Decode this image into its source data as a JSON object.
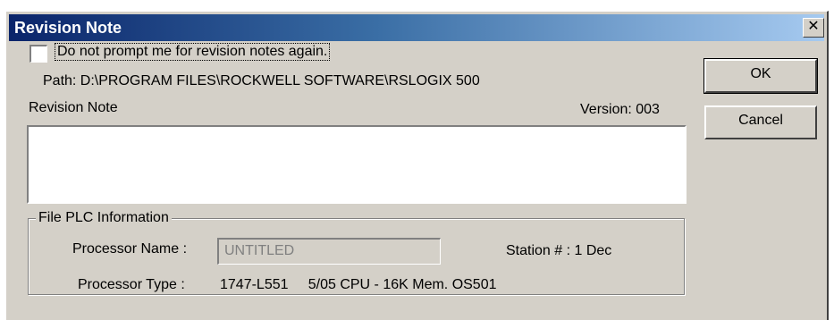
{
  "window": {
    "title": "Revision Note",
    "close_glyph": "✕"
  },
  "prompt_checkbox": {
    "label": "Do not prompt me for revision notes again.",
    "checked": false
  },
  "path": "Path: D:\\PROGRAM FILES\\ROCKWELL SOFTWARE\\RSLOGIX 500",
  "revision": {
    "label": "Revision Note",
    "version": "Version:  003",
    "note_text": ""
  },
  "plc_info": {
    "group_title": "File PLC Information",
    "processor_name_label": "Processor Name :",
    "processor_name_value": "UNTITLED",
    "station": "Station # :  1 Dec",
    "processor_type_label": "Processor Type :",
    "processor_type_value": "1747-L551     5/05 CPU - 16K Mem. OS501"
  },
  "buttons": {
    "ok": "OK",
    "cancel": "Cancel"
  }
}
